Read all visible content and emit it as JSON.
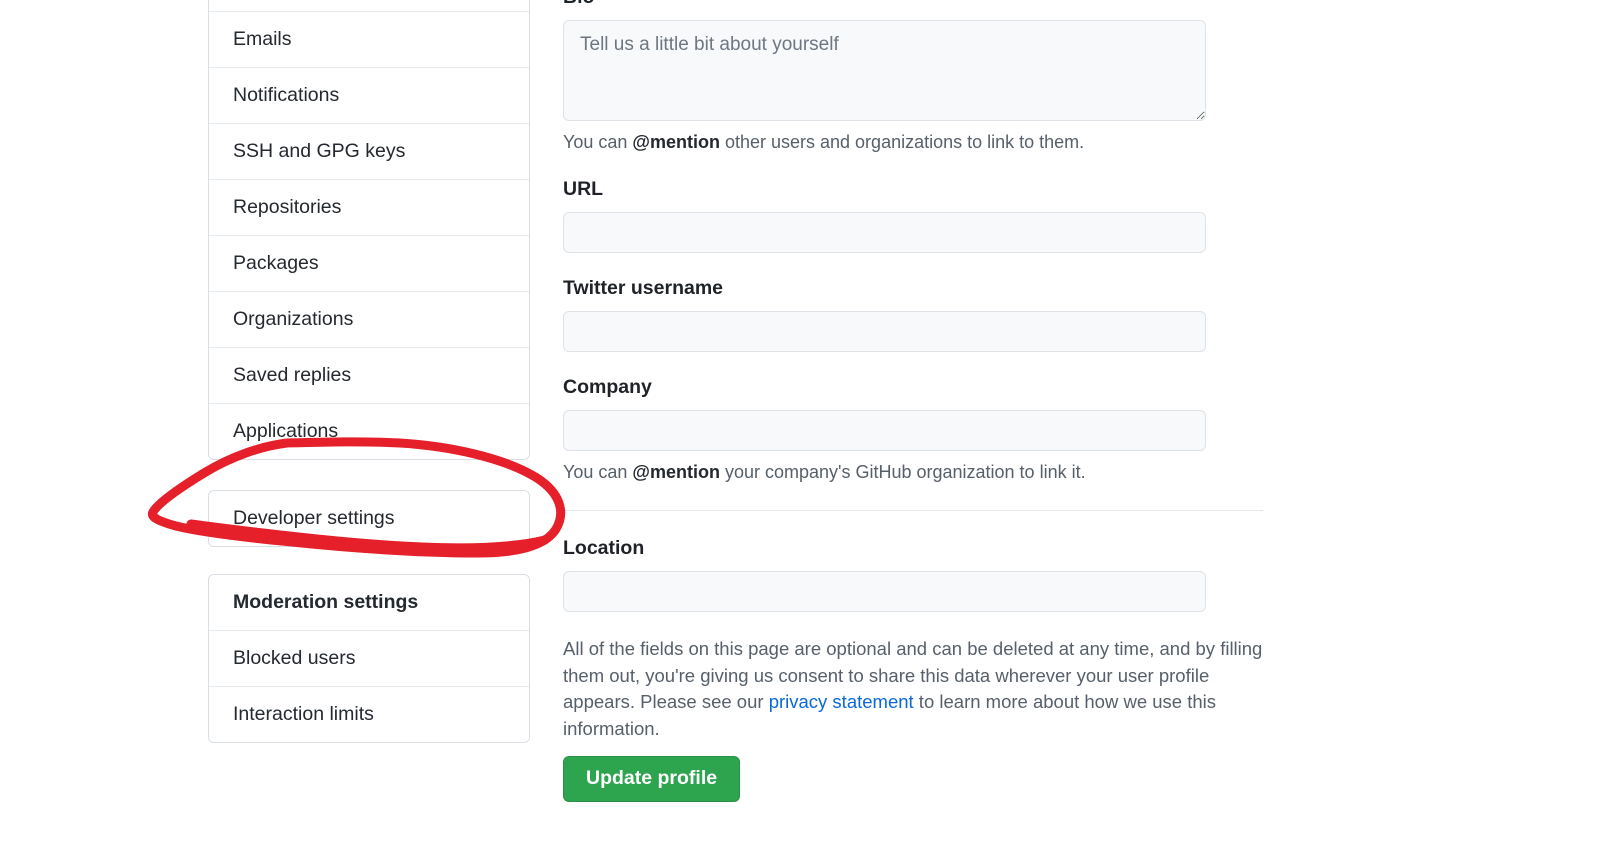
{
  "sidebar": {
    "groups": [
      {
        "name": "account-settings-group",
        "items": [
          {
            "label": "",
            "clipped": true
          },
          {
            "label": "Emails"
          },
          {
            "label": "Notifications"
          },
          {
            "label": "SSH and GPG keys"
          },
          {
            "label": "Repositories"
          },
          {
            "label": "Packages"
          },
          {
            "label": "Organizations"
          },
          {
            "label": "Saved replies"
          },
          {
            "label": "Applications"
          }
        ]
      },
      {
        "name": "developer-group",
        "items": [
          {
            "label": "Developer settings"
          }
        ]
      },
      {
        "name": "moderation-group",
        "items": [
          {
            "label": "Moderation settings",
            "bold": true
          },
          {
            "label": "Blocked users"
          },
          {
            "label": "Interaction limits"
          }
        ]
      }
    ]
  },
  "form": {
    "bio": {
      "label": "Bio",
      "placeholder": "Tell us a little bit about yourself",
      "value": "",
      "help_prefix": "You can ",
      "help_mention": "@mention",
      "help_suffix": " other users and organizations to link to them."
    },
    "url": {
      "label": "URL",
      "placeholder": "",
      "value": ""
    },
    "twitter": {
      "label": "Twitter username",
      "placeholder": "",
      "value": ""
    },
    "company": {
      "label": "Company",
      "placeholder": "",
      "value": "",
      "help_prefix": "You can ",
      "help_mention": "@mention",
      "help_suffix": " your company's GitHub organization to link it."
    },
    "location": {
      "label": "Location",
      "placeholder": "",
      "value": ""
    },
    "consent": {
      "part1": "All of the fields on this page are optional and can be deleted at any time, and by filling them out, you're giving us consent to share this data wherever your user profile appears. Please see our ",
      "link": "privacy statement",
      "part2": " to learn more about how we use this information."
    },
    "submit_label": "Update profile"
  },
  "annotation": {
    "type": "hand-drawn-circle",
    "color": "#e5202a",
    "target": "Developer settings",
    "stroke_width": 9
  },
  "colors": {
    "accent_green": "#2da44e",
    "link_blue": "#0969da",
    "annotation_red": "#e5202a",
    "border": "#d8dee4",
    "input_bg": "#f7f9fb",
    "muted_text": "#57606a"
  }
}
